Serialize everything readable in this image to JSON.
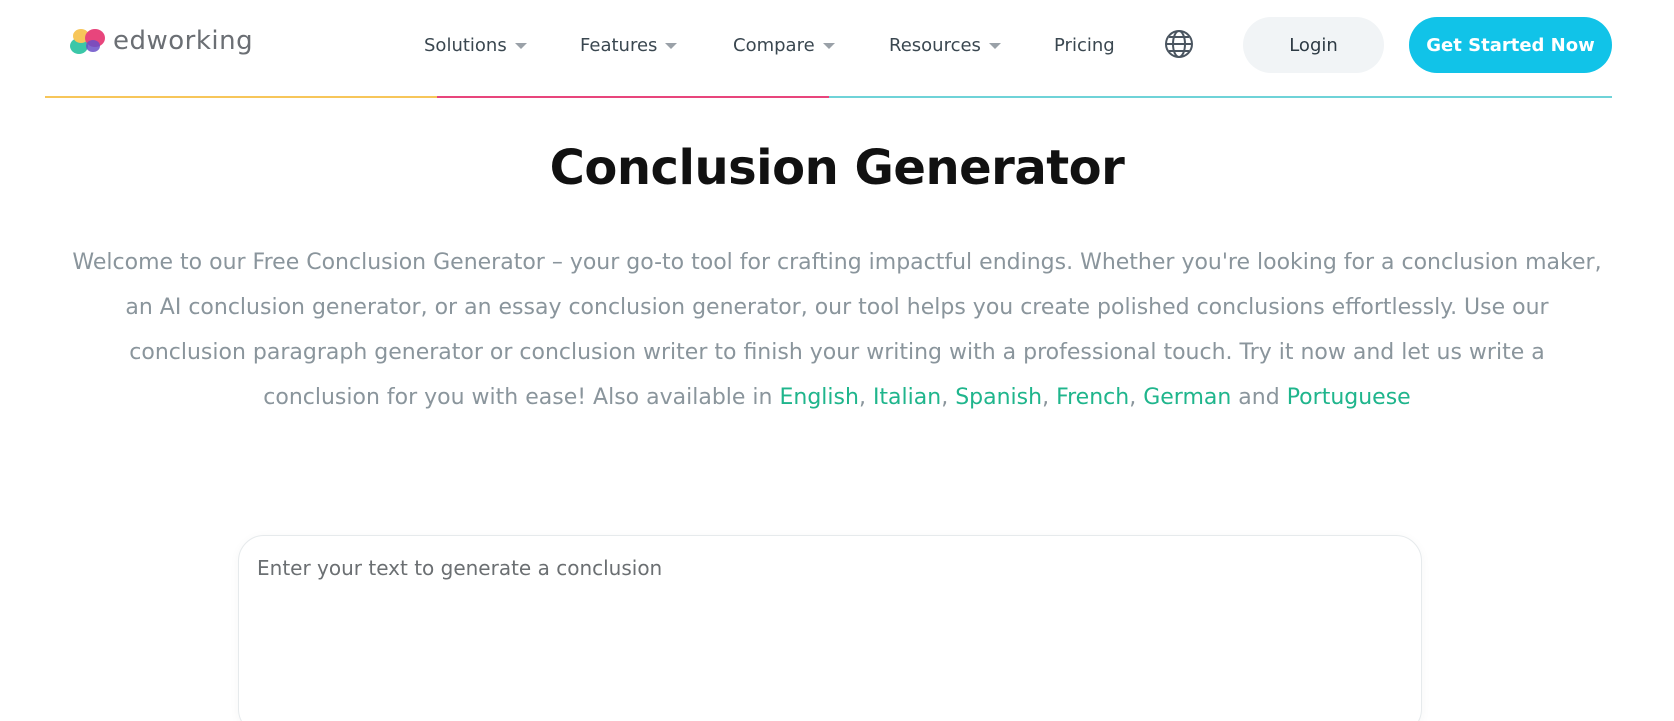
{
  "brand": {
    "name": "edworking",
    "colors": {
      "accent": "#11c3e8",
      "link": "#1fb58c",
      "rule_yellow": "#f7c65a",
      "rule_pink": "#e8457c",
      "rule_teal": "#6fd3d8"
    }
  },
  "nav": {
    "items": [
      {
        "label": "Solutions",
        "has_dropdown": true
      },
      {
        "label": "Features",
        "has_dropdown": true
      },
      {
        "label": "Compare",
        "has_dropdown": true
      },
      {
        "label": "Resources",
        "has_dropdown": true
      },
      {
        "label": "Pricing",
        "has_dropdown": false
      }
    ],
    "language_icon": "globe-icon",
    "login_label": "Login",
    "cta_label": "Get Started Now"
  },
  "page": {
    "title": "Conclusion Generator",
    "intro_text": "Welcome to our Free Conclusion Generator – your go-to tool for crafting impactful endings. Whether you're looking for a conclusion maker, an AI conclusion generator, or an essay conclusion generator, our tool helps you create polished conclusions effortlessly. Use our conclusion paragraph generator or conclusion writer to finish your writing with a professional touch. Try it now and let us write a conclusion for you with ease! Also available in ",
    "languages": [
      "English",
      "Italian",
      "Spanish",
      "French",
      "German",
      "Portuguese"
    ],
    "sep_comma": ", ",
    "sep_and": " and "
  },
  "editor": {
    "placeholder": "Enter your text to generate a conclusion",
    "value": ""
  }
}
